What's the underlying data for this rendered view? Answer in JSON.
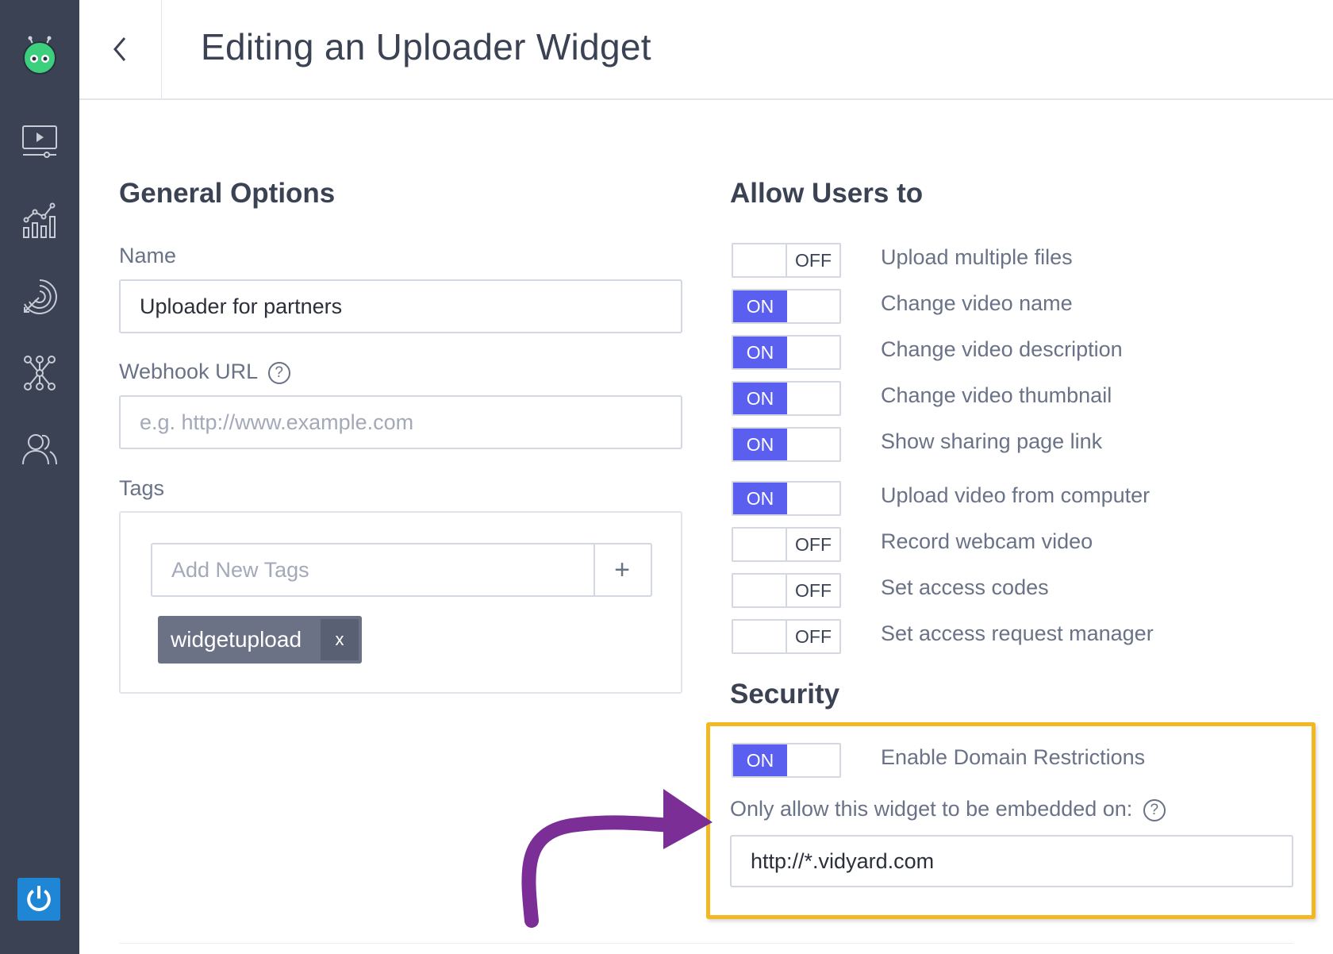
{
  "header": {
    "title": "Editing an Uploader Widget"
  },
  "sidebar": {
    "items": [
      {
        "name": "logo",
        "icon": "robot-logo-icon"
      },
      {
        "name": "videos",
        "icon": "video-player-icon"
      },
      {
        "name": "analytics",
        "icon": "analytics-chart-icon"
      },
      {
        "name": "engagement",
        "icon": "target-icon"
      },
      {
        "name": "integrations",
        "icon": "network-icon"
      },
      {
        "name": "users",
        "icon": "users-icon"
      },
      {
        "name": "power",
        "icon": "power-icon"
      }
    ]
  },
  "general": {
    "title": "General Options",
    "name_label": "Name",
    "name_value": "Uploader for partners",
    "webhook_label": "Webhook URL",
    "webhook_placeholder": "e.g. http://www.example.com",
    "tags_label": "Tags",
    "tags_placeholder": "Add New Tags",
    "add_symbol": "+",
    "tags": [
      {
        "label": "widgetupload",
        "remove": "x"
      }
    ]
  },
  "allow_users": {
    "title": "Allow Users to",
    "options": [
      {
        "label": "Upload multiple files",
        "state": "OFF"
      },
      {
        "label": "Change video name",
        "state": "ON"
      },
      {
        "label": "Change video description",
        "state": "ON"
      },
      {
        "label": "Change video thumbnail",
        "state": "ON"
      },
      {
        "label": "Show sharing page link",
        "state": "ON"
      },
      {
        "label": "Upload video from computer",
        "state": "ON"
      },
      {
        "label": "Record webcam video",
        "state": "OFF"
      },
      {
        "label": "Set access codes",
        "state": "OFF"
      },
      {
        "label": "Set access request manager",
        "state": "OFF"
      }
    ]
  },
  "security": {
    "title": "Security",
    "domain_restriction": {
      "label": "Enable Domain Restrictions",
      "state": "ON"
    },
    "embed_label": "Only allow this widget to be embedded on:",
    "embed_value": "http://*.vidyard.com"
  },
  "colors": {
    "accent": "#5a5ff0",
    "sidebar": "#3b4253",
    "highlight": "#f2b824",
    "arrow": "#7b2e96",
    "logo_green": "#3ccf7d"
  }
}
